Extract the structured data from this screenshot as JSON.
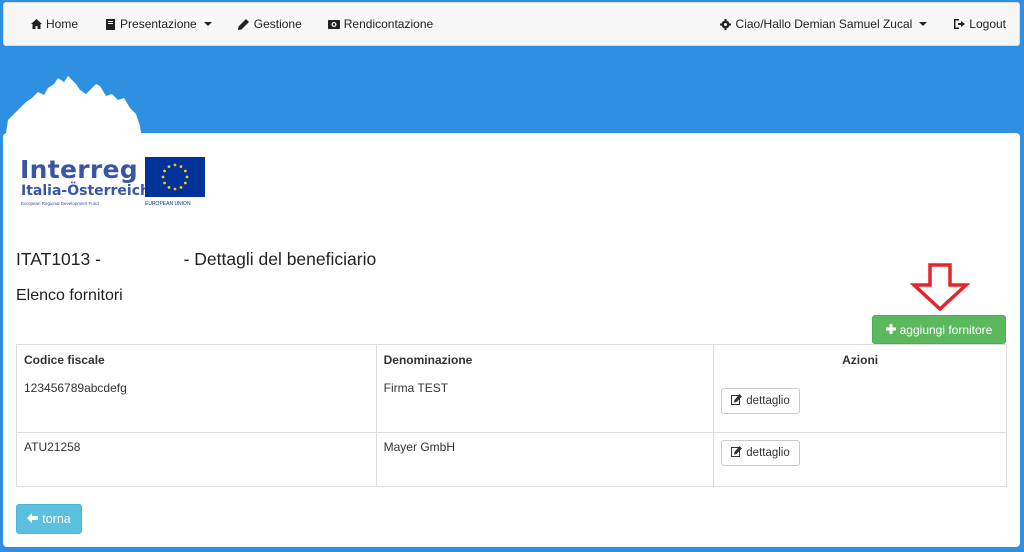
{
  "navbar": {
    "home": "Home",
    "presentazione": "Presentazione",
    "gestione": "Gestione",
    "rendicontazione": "Rendicontazione",
    "user": "Ciao/Hallo Demian Samuel Zucal",
    "logout": "Logout"
  },
  "logo": {
    "name": "Interreg",
    "subtitle": "Italia-Österreich",
    "fund": "European Regional Development Fund",
    "eu_label": "EUROPEAN UNION"
  },
  "page": {
    "title": "ITAT1013 -                 - Dettagli del beneficiario",
    "subtitle": "Elenco fornitori"
  },
  "buttons": {
    "add_supplier": "aggiungi fornitore",
    "back": "torna"
  },
  "table": {
    "headers": {
      "codice_fiscale": "Codice fiscale",
      "denominazione": "Denominazione",
      "azioni": "Azioni"
    },
    "rows": [
      {
        "codice_fiscale": "123456789abcdefg",
        "denominazione": "Firma TEST",
        "action_label": "dettaglio"
      },
      {
        "codice_fiscale": "ATU21258",
        "denominazione": "Mayer GmbH",
        "action_label": "dettaglio"
      }
    ]
  },
  "colors": {
    "background": "#2f8fe0",
    "success": "#5cb85c",
    "info": "#5bc0de",
    "annotation_arrow": "#e3262b",
    "brand": "#3a55a4"
  },
  "icons": {
    "home": "home-icon",
    "presentazione": "book-icon",
    "gestione": "pencil-icon",
    "rendicontazione": "eye-icon",
    "user": "gear-icon",
    "logout": "logout-icon",
    "add": "plus-icon",
    "detail": "edit-icon",
    "back": "arrow-left-icon"
  }
}
